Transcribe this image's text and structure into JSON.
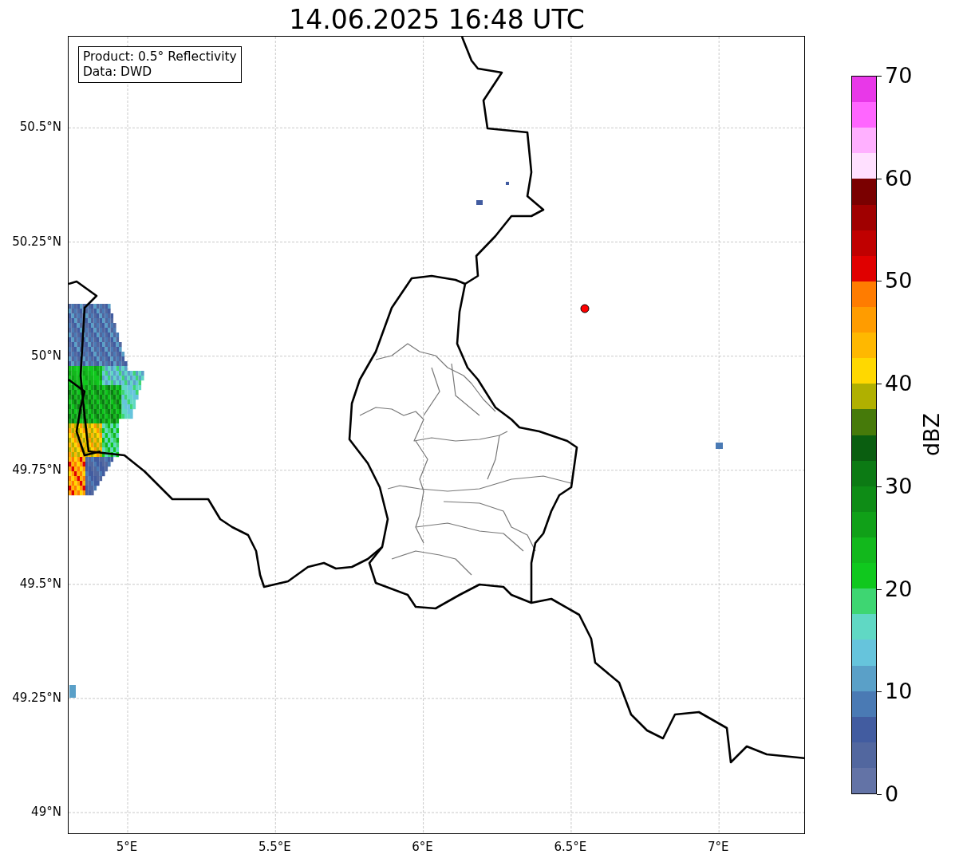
{
  "title": "14.06.2025 16:48 UTC",
  "info_box": {
    "lines": [
      "Product: 0.5° Reflectivity",
      "Data: DWD"
    ]
  },
  "map": {
    "xticks": [
      "5°E",
      "5.5°E",
      "6°E",
      "6.5°E",
      "7°E"
    ],
    "yticks": [
      "50.5°N",
      "50.25°N",
      "50°N",
      "49.75°N",
      "49.5°N",
      "49.25°N",
      "49°N"
    ]
  },
  "colorbar": {
    "label": "dBZ",
    "ticks": [
      "70",
      "60",
      "50",
      "40",
      "30",
      "20",
      "10",
      "0"
    ],
    "bins": [
      {
        "color": "#e838e8"
      },
      {
        "color": "#ff66ff"
      },
      {
        "color": "#ffb0ff"
      },
      {
        "color": "#ffe0ff"
      },
      {
        "color": "#7a0000"
      },
      {
        "color": "#a00000"
      },
      {
        "color": "#c00000"
      },
      {
        "color": "#e00000"
      },
      {
        "color": "#ff7c00"
      },
      {
        "color": "#ff9c00"
      },
      {
        "color": "#ffb800"
      },
      {
        "color": "#ffd800"
      },
      {
        "color": "#b0b000"
      },
      {
        "color": "#467a0a"
      },
      {
        "color": "#0a5e10"
      },
      {
        "color": "#0c7a14"
      },
      {
        "color": "#0e8c16"
      },
      {
        "color": "#10a018"
      },
      {
        "color": "#12b81c"
      },
      {
        "color": "#10c81e"
      },
      {
        "color": "#3ed672"
      },
      {
        "color": "#60d8c4"
      },
      {
        "color": "#66c4dc"
      },
      {
        "color": "#5aa0c8"
      },
      {
        "color": "#4a7ab4"
      },
      {
        "color": "#425ca0"
      },
      {
        "color": "#52679f"
      },
      {
        "color": "#6373a6"
      }
    ]
  }
}
